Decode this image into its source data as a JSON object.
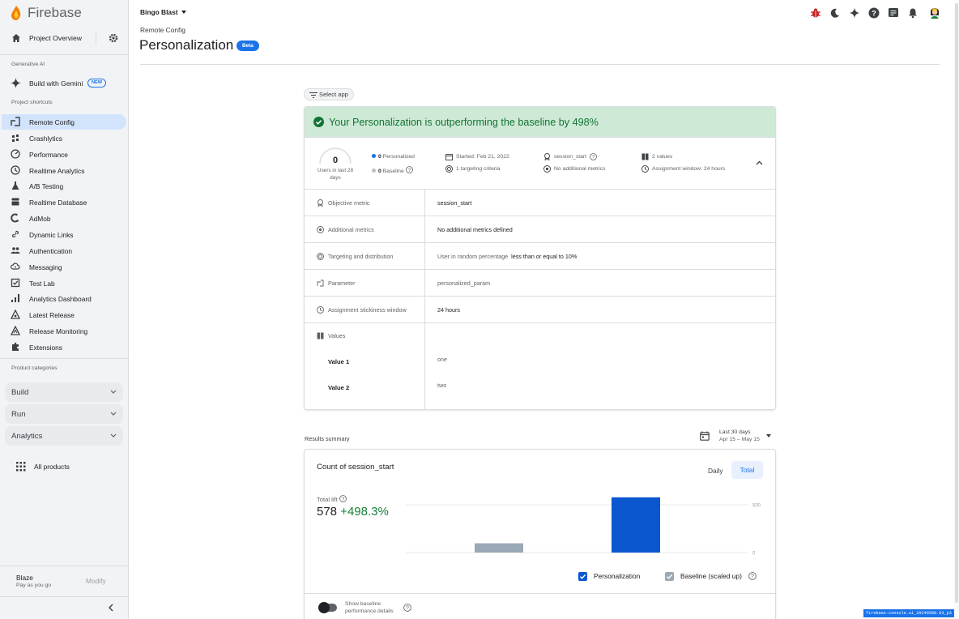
{
  "sidebar": {
    "brand": "Firebase",
    "project_overview": "Project Overview",
    "section_generative_ai": "Generative AI",
    "build_with_gemini": "Build with Gemini",
    "new_badge": "NEW",
    "section_shortcuts": "Project shortcuts",
    "items": [
      {
        "label": "Remote Config",
        "icon": "remote-config-icon",
        "active": true
      },
      {
        "label": "Crashlytics",
        "icon": "crashlytics-icon"
      },
      {
        "label": "Performance",
        "icon": "performance-icon"
      },
      {
        "label": "Realtime Analytics",
        "icon": "clock-icon"
      },
      {
        "label": "A/B Testing",
        "icon": "flask-icon"
      },
      {
        "label": "Realtime Database",
        "icon": "database-icon"
      },
      {
        "label": "AdMob",
        "icon": "admob-icon"
      },
      {
        "label": "Dynamic Links",
        "icon": "link-icon"
      },
      {
        "label": "Authentication",
        "icon": "people-icon"
      },
      {
        "label": "Messaging",
        "icon": "cloud-messaging-icon"
      },
      {
        "label": "Test Lab",
        "icon": "test-lab-icon"
      },
      {
        "label": "Analytics Dashboard",
        "icon": "bar-chart-icon"
      },
      {
        "label": "Latest Release",
        "icon": "release-icon"
      },
      {
        "label": "Release Monitoring",
        "icon": "release-monitor-icon"
      },
      {
        "label": "Extensions",
        "icon": "puzzle-icon"
      }
    ],
    "section_categories": "Product categories",
    "categories": [
      "Build",
      "Run",
      "Analytics"
    ],
    "all_products": "All products",
    "plan_name": "Blaze",
    "plan_sub": "Pay as you go",
    "modify": "Modify"
  },
  "header": {
    "project": "Bingo Blast",
    "breadcrumb": "Remote Config",
    "title": "Personalization",
    "badge": "Beta",
    "icons": [
      "bug-icon",
      "dark-mode-icon",
      "gemini-icon",
      "help-icon",
      "feedback-icon",
      "notifications-icon",
      "avatar"
    ]
  },
  "main": {
    "select_app": "Select app",
    "banner": "Your Personalization is outperforming the baseline by 498%",
    "stats": {
      "users_count": "0",
      "users_label": "Users in last 28 days",
      "personalized_count": "0",
      "personalized_label": "Personalized",
      "baseline_count": "0",
      "baseline_label": "Baseline",
      "started": "Started: Feb 21, 2022",
      "targeting": "1 targeting criteria",
      "metric": "session_start",
      "additional": "No additional metrics",
      "values": "2 values",
      "window": "Assignment window: 24 hours"
    },
    "rows": [
      {
        "label": "Objective metric",
        "value": "session_start",
        "icon": "objective-icon"
      },
      {
        "label": "Additional metrics",
        "value": "No additional metrics defined",
        "icon": "additional-metrics-icon"
      },
      {
        "label": "Targeting and distribution",
        "value_prefix": "User in random percentage",
        "value": "less than or equal to 10%",
        "icon": "target-icon"
      },
      {
        "label": "Parameter",
        "value": "personalized_param",
        "icon": "parameter-icon"
      },
      {
        "label": "Assignment stickiness window",
        "value": "24 hours",
        "icon": "clock-icon"
      }
    ],
    "values_label": "Values",
    "values": [
      {
        "name": "Value 1",
        "value": "one"
      },
      {
        "name": "Value 2",
        "value": "two"
      }
    ]
  },
  "results": {
    "label": "Results summary",
    "date_range": "Last 30 days",
    "date_sub": "Apr 15 – May 15",
    "card_title": "Count of session_start",
    "daily": "Daily",
    "total": "Total",
    "total_lift_label": "Total lift",
    "total_value": "578",
    "lift": "+498.3%",
    "legend_personalization": "Personalization",
    "legend_baseline": "Baseline (scaled up)",
    "toggle_label_1": "Show baseline",
    "toggle_label_2": "performance details"
  },
  "chart_data": {
    "type": "bar",
    "categories": [
      "Baseline (scaled up)",
      "Personalization"
    ],
    "values": [
      97,
      578
    ],
    "yticks": [
      "500",
      "0"
    ],
    "ylim": [
      0,
      600
    ],
    "colors": {
      "baseline": "#9aa9b5",
      "personalization": "#0b57d0"
    }
  },
  "build_tag": "firebase-console.ui_20240509.03_p3"
}
